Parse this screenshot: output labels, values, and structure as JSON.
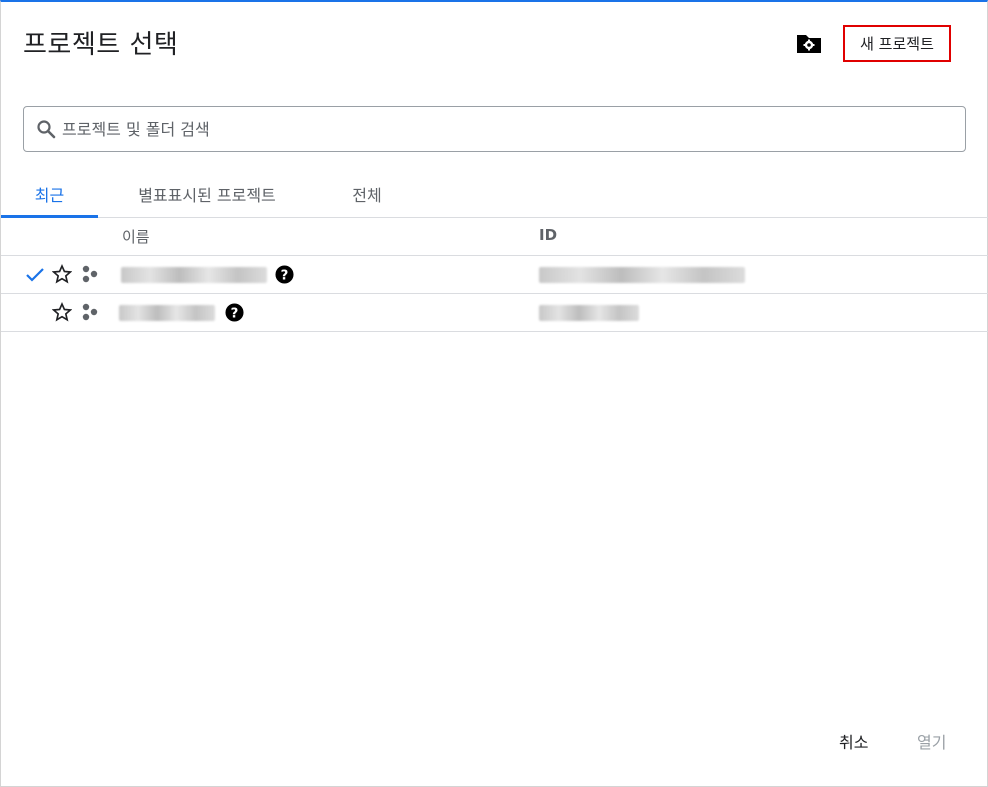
{
  "header": {
    "title": "프로젝트 선택",
    "new_project_label": "새 프로젝트"
  },
  "search": {
    "placeholder": "프로젝트 및 폴더 검색",
    "value": ""
  },
  "tabs": [
    {
      "label": "최근",
      "active": true
    },
    {
      "label": "별표표시된 프로젝트",
      "active": false
    },
    {
      "label": "전체",
      "active": false
    }
  ],
  "table": {
    "columns": [
      "이름",
      "ID"
    ],
    "rows": [
      {
        "selected": true,
        "starred": false,
        "name": "",
        "id": ""
      },
      {
        "selected": false,
        "starred": false,
        "name": "",
        "id": ""
      }
    ]
  },
  "footer": {
    "cancel_label": "취소",
    "open_label": "열기"
  },
  "colors": {
    "accent": "#1a73e8",
    "highlight_box": "#e00000",
    "text": "#202124",
    "muted": "#5f6368",
    "disabled": "#9aa0a6"
  }
}
